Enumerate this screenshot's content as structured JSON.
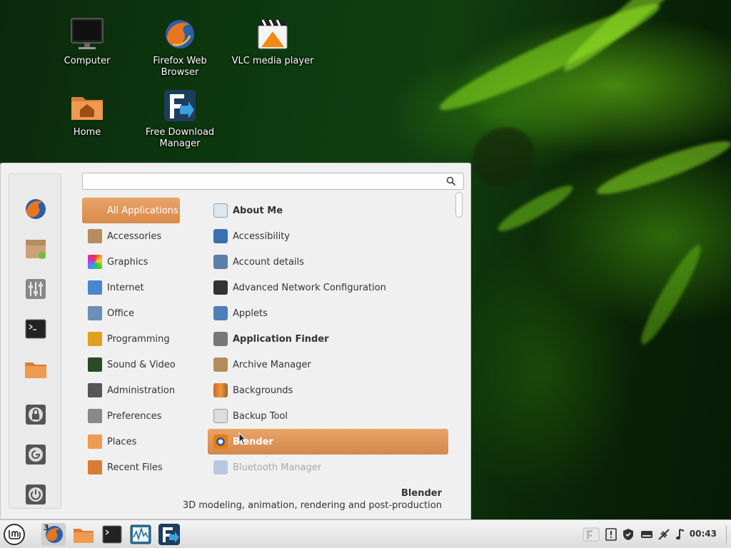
{
  "desktop": {
    "icons": [
      {
        "label": "Computer",
        "icon": "monitor-icon"
      },
      {
        "label": "Firefox Web Browser",
        "icon": "firefox-icon"
      },
      {
        "label": "VLC media player",
        "icon": "vlc-icon"
      },
      {
        "label": "Home",
        "icon": "home-folder-icon"
      },
      {
        "label": "Free Download Manager",
        "icon": "fdm-icon"
      }
    ]
  },
  "menu": {
    "search": {
      "value": "",
      "placeholder": ""
    },
    "favorites": [
      "firefox-icon",
      "package-icon",
      "settings-sliders-icon",
      "terminal-icon",
      "folder-icon",
      "lock-icon",
      "logout-icon",
      "power-icon"
    ],
    "categories": [
      {
        "label": "All Applications",
        "active": true
      },
      {
        "label": "Accessories"
      },
      {
        "label": "Graphics"
      },
      {
        "label": "Internet"
      },
      {
        "label": "Office"
      },
      {
        "label": "Programming"
      },
      {
        "label": "Sound & Video"
      },
      {
        "label": "Administration"
      },
      {
        "label": "Preferences"
      },
      {
        "label": "Places"
      },
      {
        "label": "Recent Files"
      }
    ],
    "apps": [
      {
        "label": "About Me"
      },
      {
        "label": "Accessibility"
      },
      {
        "label": "Account details"
      },
      {
        "label": "Advanced Network Configuration"
      },
      {
        "label": "Applets"
      },
      {
        "label": "Application Finder"
      },
      {
        "label": "Archive Manager"
      },
      {
        "label": "Backgrounds"
      },
      {
        "label": "Backup Tool"
      },
      {
        "label": "Blender"
      },
      {
        "label": "Bluetooth Manager"
      }
    ],
    "description": {
      "title": "Blender",
      "subtitle": "3D modeling, animation, rendering and post-production"
    }
  },
  "taskbar": {
    "firefox_badge": "3",
    "clock": "00:43"
  },
  "colors": {
    "accent": "#d98a4a",
    "menu_bg": "#f0f0f0",
    "taskbar_bg": "#e6e6e6"
  }
}
